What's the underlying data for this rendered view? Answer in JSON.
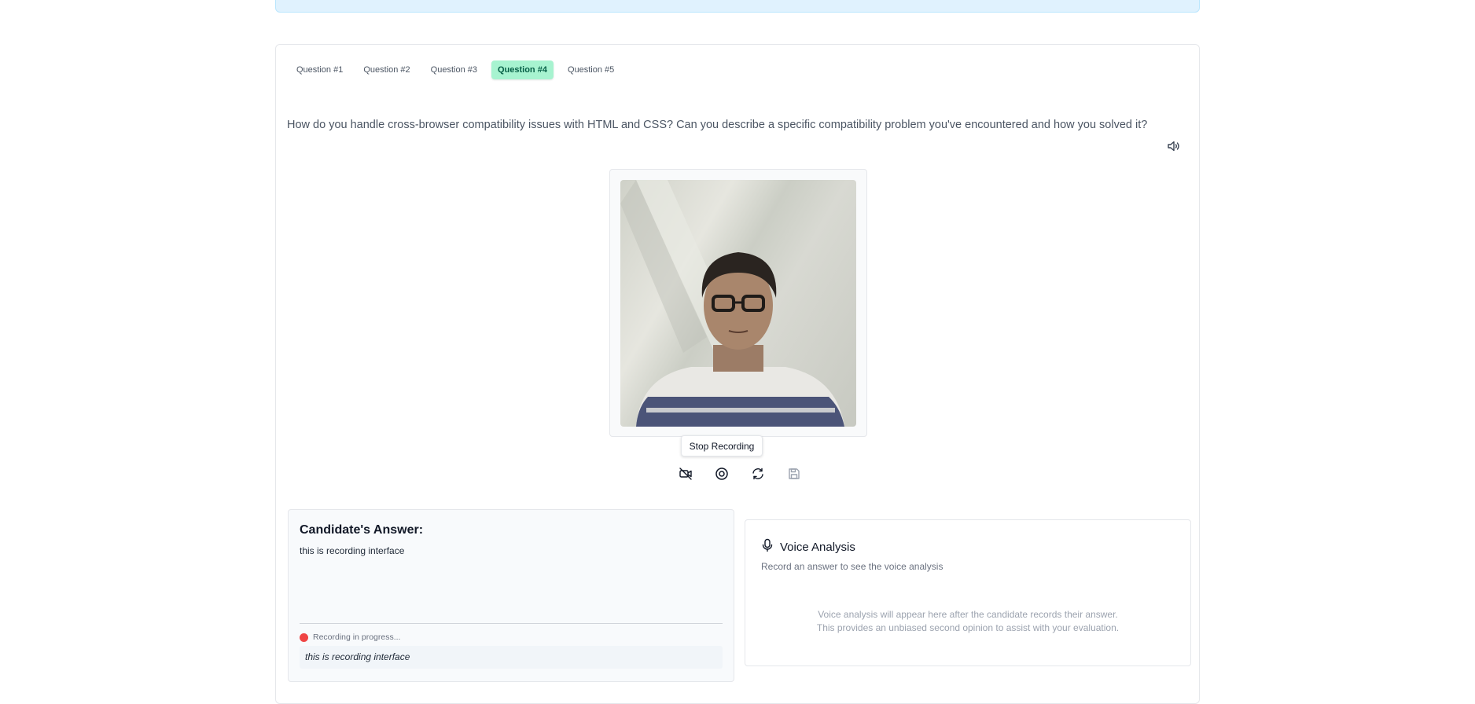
{
  "tabs": [
    {
      "label": "Question #1",
      "active": false
    },
    {
      "label": "Question #2",
      "active": false
    },
    {
      "label": "Question #3",
      "active": false
    },
    {
      "label": "Question #4",
      "active": true
    },
    {
      "label": "Question #5",
      "active": false
    }
  ],
  "question": {
    "text": "How do you handle cross-browser compatibility issues with HTML and CSS? Can you describe a specific compatibility problem you've encountered and how you solved it?"
  },
  "video": {
    "tooltip": "Stop Recording",
    "controls": [
      "camera-off-icon",
      "record-icon",
      "refresh-icon",
      "save-icon"
    ]
  },
  "answer": {
    "title": "Candidate's Answer:",
    "text": "this is recording interface",
    "status": "Recording in progress...",
    "transcript": "this is recording interface"
  },
  "voice": {
    "title": "Voice Analysis",
    "subtitle": "Record an answer to see the voice analysis",
    "note_line1": "Voice analysis will appear here after the candidate records their answer.",
    "note_line2": "This provides an unbiased second opinion to assist with your evaluation."
  },
  "colors": {
    "active_tab": "#a7f3d0",
    "recording_dot": "#ef4444",
    "banner": "#e0f2fe"
  }
}
